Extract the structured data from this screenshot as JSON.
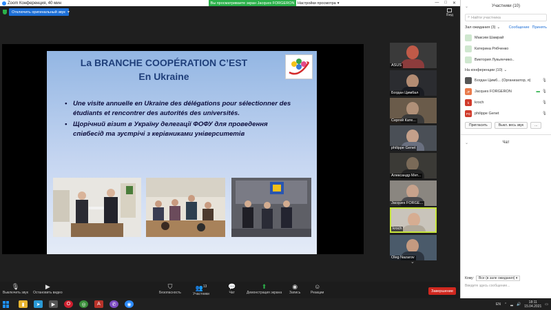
{
  "window": {
    "title": "Zoom Конференция, 40 мин",
    "share_banner": "Вы просматриваете экран Jacques FORGERON",
    "view_options": "Настройки просмотра"
  },
  "meeting": {
    "original_sound": "Отключить оригинальный звук",
    "view_label": "Вид"
  },
  "slide": {
    "title_line1": "La BRANCHE COOPÉRATION C’EST",
    "title_line2": "En Ukraine",
    "bullets": [
      "Une visite annuelle en Ukraine des délégations pour sélectionner des étudiants et rencontrer des autorités des universités.",
      "Щорічний візит в Україну делегації ФОФУ для проведення співбесід та зустрічі з керівниками університетів"
    ]
  },
  "tiles": [
    {
      "name": "ASUS"
    },
    {
      "name": "Богдан Цимбал"
    },
    {
      "name": "Сергей Кате..."
    },
    {
      "name": "philippe Genet"
    },
    {
      "name": "Александр Мет..."
    },
    {
      "name": "Jacques FORGE..."
    },
    {
      "name": "kroch"
    },
    {
      "name": "Oleg Nazarov"
    }
  ],
  "toolbar": {
    "mute": "Выключить звук",
    "video": "Остановить видео",
    "security": "Безопасность",
    "participants": "Участники",
    "participants_count": "13",
    "chat": "Чат",
    "share": "Демонстрация экрана",
    "record": "Запись",
    "reactions": "Реакции",
    "end": "Завершение"
  },
  "panel": {
    "title": "Участники (10)",
    "search_placeholder": "Найти участника",
    "waiting_label": "Зал ожидания (3)",
    "waiting_message": "Сообщение",
    "waiting_admit": "Принять",
    "waiting": [
      {
        "name": "Максим Шамрай",
        "initial": "",
        "color": "#cfe7cf"
      },
      {
        "name": "Катерина Рябченко",
        "initial": "",
        "color": "#cfe7cf"
      },
      {
        "name": "Виктория Лукьянчико..",
        "initial": "",
        "color": "#cfe7cf"
      }
    ],
    "in_meeting_label": "На конференции (10)",
    "in_meeting": [
      {
        "name": "Богдан Цимб... (Организатор, я)",
        "initial": "",
        "color": "#555555"
      },
      {
        "name": "Jacques FORGERON",
        "initial": "JF",
        "color": "#e8794a"
      },
      {
        "name": "kroch",
        "initial": "k",
        "color": "#d03a2a"
      },
      {
        "name": "philippe Genet",
        "initial": "PG",
        "color": "#d03a2a"
      }
    ],
    "invite": "Пригласить",
    "mute_all": "Выкл. весь звук",
    "more": "...",
    "chat_title": "Чат",
    "chat_to_label": "Кому:",
    "chat_to_value": "Все (в зале ожидания)",
    "chat_placeholder": "Введите здесь сообщение..."
  },
  "taskbar": {
    "lang": "EN",
    "time": "18:11",
    "date": "15.04.2021"
  }
}
